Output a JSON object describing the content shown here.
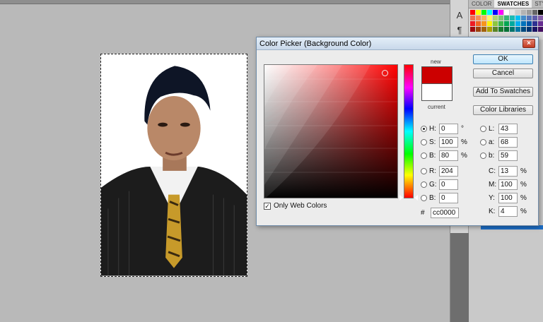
{
  "panel": {
    "tabs": [
      "COLOR",
      "SWATCHES",
      "STYL"
    ],
    "tool_a": "A",
    "tool_para": "¶"
  },
  "dialog": {
    "title": "Color Picker (Background Color)",
    "close": "×",
    "new_label": "new",
    "current_label": "current",
    "new_color": "#cc0000",
    "current_color": "#ffffff",
    "buttons": {
      "ok": "OK",
      "cancel": "Cancel",
      "add_to_swatches": "Add To Swatches",
      "color_libraries": "Color Libraries"
    },
    "hsb": {
      "h_label": "H:",
      "h_value": "0",
      "h_unit": "°",
      "s_label": "S:",
      "s_value": "100",
      "s_unit": "%",
      "b_label": "B:",
      "b_value": "80",
      "b_unit": "%"
    },
    "rgb": {
      "r_label": "R:",
      "r_value": "204",
      "g_label": "G:",
      "g_value": "0",
      "b_label": "B:",
      "b_value": "0"
    },
    "lab": {
      "l_label": "L:",
      "l_value": "43",
      "a_label": "a:",
      "a_value": "68",
      "b_label": "b:",
      "b_value": "59"
    },
    "cmyk": {
      "c_label": "C:",
      "c_value": "13",
      "c_unit": "%",
      "m_label": "M:",
      "m_value": "100",
      "m_unit": "%",
      "y_label": "Y:",
      "y_value": "100",
      "y_unit": "%",
      "k_label": "K:",
      "k_value": "4",
      "k_unit": "%"
    },
    "hex_label": "#",
    "hex_value": "cc0000",
    "only_web_colors": "Only Web Colors",
    "only_web_checked": "✓"
  }
}
